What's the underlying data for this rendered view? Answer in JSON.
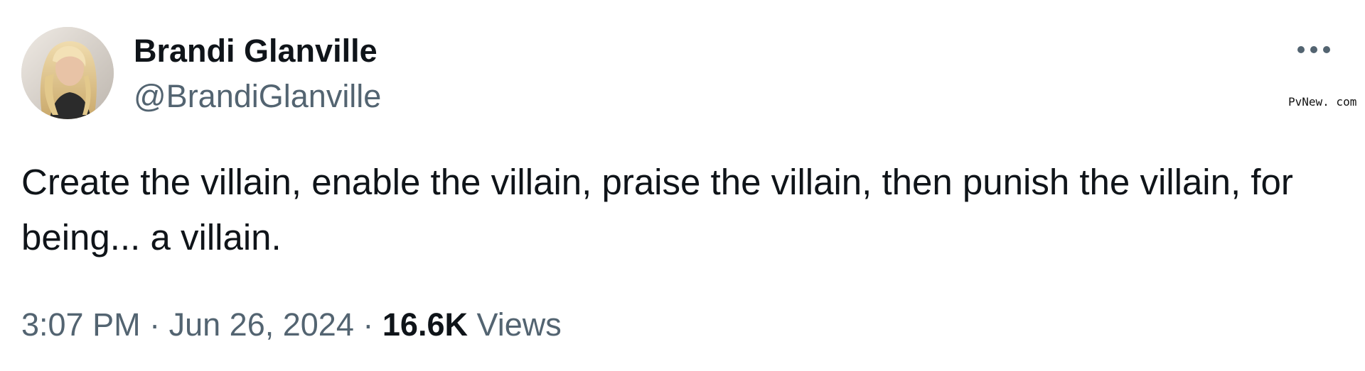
{
  "author": {
    "display_name": "Brandi Glanville",
    "handle": "@BrandiGlanville",
    "avatar_icon": "profile-photo"
  },
  "menu": {
    "more_icon": "more-horizontal-icon"
  },
  "tweet": {
    "text": "Create the villain, enable the villain, praise the villain, then punish the villain, for being... a villain."
  },
  "meta": {
    "time": "3:07 PM",
    "separator": "·",
    "date": "Jun 26, 2024",
    "views_count": "16.6K",
    "views_label": "Views"
  },
  "watermark": "PvNew. com",
  "colors": {
    "primary_text": "#0f1419",
    "secondary_text": "#536471",
    "background": "#ffffff"
  }
}
